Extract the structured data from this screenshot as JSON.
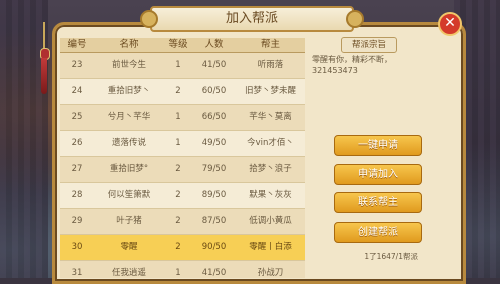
{
  "dialog": {
    "title": "加入帮派"
  },
  "table": {
    "headers": [
      "编号",
      "名称",
      "等级",
      "人数",
      "帮主"
    ],
    "rows": [
      {
        "id": "23",
        "name": "前世今生",
        "level": "1",
        "members": "41/50",
        "leader": "听雨落"
      },
      {
        "id": "24",
        "name": "重拾旧梦丶",
        "level": "2",
        "members": "60/50",
        "leader": "旧梦丶梦未醒"
      },
      {
        "id": "25",
        "name": "兮月丶芊华",
        "level": "1",
        "members": "66/50",
        "leader": "芊华丶莫离"
      },
      {
        "id": "26",
        "name": "遗落传说",
        "level": "1",
        "members": "49/50",
        "leader": "今vin才佰丶"
      },
      {
        "id": "27",
        "name": "重拾旧梦°",
        "level": "2",
        "members": "79/50",
        "leader": "拾梦丶浪子"
      },
      {
        "id": "28",
        "name": "何以笙箫默",
        "level": "2",
        "members": "89/50",
        "leader": "默果丶灰灰"
      },
      {
        "id": "29",
        "name": "叶子猪",
        "level": "2",
        "members": "87/50",
        "leader": "低调小黄瓜"
      },
      {
        "id": "30",
        "name": "零醒",
        "level": "2",
        "members": "90/50",
        "leader": "零醒丨白添"
      },
      {
        "id": "31",
        "name": "任我逍遥",
        "level": "1",
        "members": "41/50",
        "leader": "孙战刀"
      }
    ],
    "selected_index": 7
  },
  "info": {
    "label": "帮派宗旨",
    "text": "零醒有你，精彩不断，321453473"
  },
  "buttons": {
    "one_click_apply": "一键申请",
    "apply_join": "申请加入",
    "contact_leader": "联系帮主",
    "create_guild": "创建帮派"
  },
  "footer": {
    "count_text": "1了1647/1帮派"
  }
}
